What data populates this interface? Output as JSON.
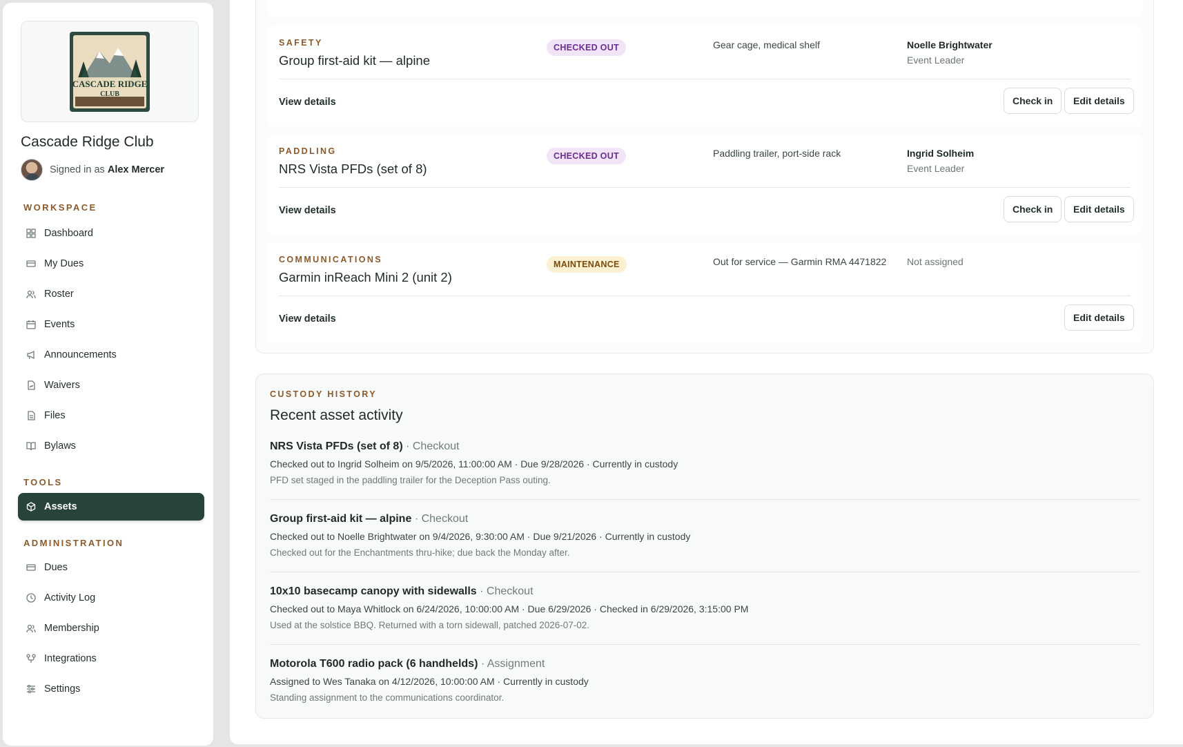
{
  "sidebar": {
    "club_name": "Cascade Ridge Club",
    "signed_in_prefix": "Signed in as",
    "user_name": "Alex Mercer",
    "logo_text": {
      "line1": "CASCADE RIDGE",
      "line2": "CLUB"
    },
    "sections": {
      "workspace": "WORKSPACE",
      "tools": "TOOLS",
      "administration": "ADMINISTRATION"
    },
    "workspace_items": [
      {
        "label": "Dashboard",
        "icon": "grid-icon"
      },
      {
        "label": "My Dues",
        "icon": "card-icon"
      },
      {
        "label": "Roster",
        "icon": "users-icon"
      },
      {
        "label": "Events",
        "icon": "calendar-icon"
      },
      {
        "label": "Announcements",
        "icon": "megaphone-icon"
      },
      {
        "label": "Waivers",
        "icon": "document-sign-icon"
      },
      {
        "label": "Files",
        "icon": "file-icon"
      },
      {
        "label": "Bylaws",
        "icon": "book-icon"
      }
    ],
    "tools_items": [
      {
        "label": "Assets",
        "icon": "box-icon",
        "active": true
      }
    ],
    "admin_items": [
      {
        "label": "Dues",
        "icon": "card-icon"
      },
      {
        "label": "Activity Log",
        "icon": "clock-icon"
      },
      {
        "label": "Membership",
        "icon": "users-icon"
      },
      {
        "label": "Integrations",
        "icon": "plug-icon"
      },
      {
        "label": "Settings",
        "icon": "sliders-icon"
      }
    ]
  },
  "assets": [
    {
      "category": "SAFETY",
      "name": "Group first-aid kit — alpine",
      "status": "CHECKED OUT",
      "location": "Gear cage, medical shelf",
      "holder": "Noelle Brightwater",
      "holder_role": "Event Leader",
      "view_label": "View details",
      "check_in_label": "Check in",
      "edit_label": "Edit details"
    },
    {
      "category": "PADDLING",
      "name": "NRS Vista PFDs (set of 8)",
      "status": "CHECKED OUT",
      "location": "Paddling trailer, port-side rack",
      "holder": "Ingrid Solheim",
      "holder_role": "Event Leader",
      "view_label": "View details",
      "check_in_label": "Check in",
      "edit_label": "Edit details"
    },
    {
      "category": "COMMUNICATIONS",
      "name": "Garmin inReach Mini 2 (unit 2)",
      "status": "MAINTENANCE",
      "location": "Out for service — Garmin RMA 4471822",
      "holder_none": "Not assigned",
      "view_label": "View details",
      "edit_label": "Edit details"
    }
  ],
  "history": {
    "label": "CUSTODY HISTORY",
    "title": "Recent asset activity",
    "items": [
      {
        "asset": "NRS Vista PFDs (set of 8)",
        "kind": "· Checkout",
        "detail": "Checked out to Ingrid Solheim on 9/5/2026, 11:00:00 AM · Due 9/28/2026 · Currently in custody",
        "note": "PFD set staged in the paddling trailer for the Deception Pass outing."
      },
      {
        "asset": "Group first-aid kit — alpine",
        "kind": "· Checkout",
        "detail": "Checked out to Noelle Brightwater on 9/4/2026, 9:30:00 AM · Due 9/21/2026 · Currently in custody",
        "note": "Checked out for the Enchantments thru-hike; due back the Monday after."
      },
      {
        "asset": "10x10 basecamp canopy with sidewalls",
        "kind": "· Checkout",
        "detail": "Checked out to Maya Whitlock on 6/24/2026, 10:00:00 AM · Due 6/29/2026 · Checked in 6/29/2026, 3:15:00 PM",
        "note": "Used at the solstice BBQ. Returned with a torn sidewall, patched 2026-07-02."
      },
      {
        "asset": "Motorola T600 radio pack (6 handhelds)",
        "kind": "· Assignment",
        "detail": "Assigned to Wes Tanaka on 4/12/2026, 10:00:00 AM · Currently in custody",
        "note": "Standing assignment to the communications coordinator."
      }
    ]
  }
}
